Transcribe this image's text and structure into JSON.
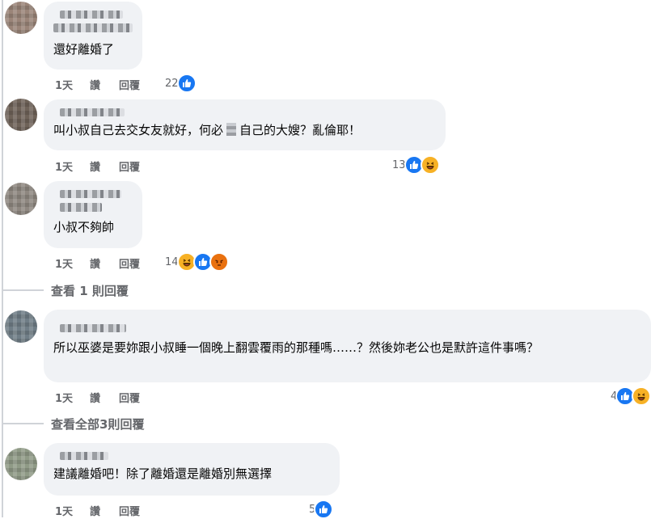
{
  "comments": [
    {
      "text": "還好離婚了",
      "time": "1天",
      "like": "讚",
      "reply": "回覆",
      "reaction_count": "22",
      "reactions": [
        "like-icon"
      ]
    },
    {
      "text_before": "叫小叔自己去交女友就好，何必",
      "text_after": "自己的大嫂？亂倫耶！",
      "time": "1天",
      "like": "讚",
      "reply": "回覆",
      "reaction_count": "13",
      "reactions": [
        "like-icon",
        "haha-icon"
      ]
    },
    {
      "text": "小叔不夠帥",
      "time": "1天",
      "like": "讚",
      "reply": "回覆",
      "reaction_count": "14",
      "reactions": [
        "haha-icon",
        "like-icon",
        "angry-icon"
      ],
      "view_replies": "查看 1 則回覆"
    },
    {
      "text": "所以巫婆是要妳跟小叔睡一個晚上翻雲覆雨的那種嗎……？然後妳老公也是默許這件事嗎？",
      "time": "1天",
      "like": "讚",
      "reply": "回覆",
      "reaction_count": "4",
      "reactions": [
        "like-icon",
        "haha-icon"
      ],
      "view_replies": "查看全部3則回覆"
    },
    {
      "text": "建議離婚吧！除了離婚還是離婚別無選擇",
      "time": "1天",
      "like": "讚",
      "reply": "回覆",
      "reaction_count": "5",
      "reactions": [
        "like-icon"
      ]
    }
  ],
  "colors": {
    "like": "#1877f2",
    "haha": "#f7b125",
    "angry": "#e9710f",
    "bubble": "#f0f2f5",
    "meta": "#65676b"
  }
}
